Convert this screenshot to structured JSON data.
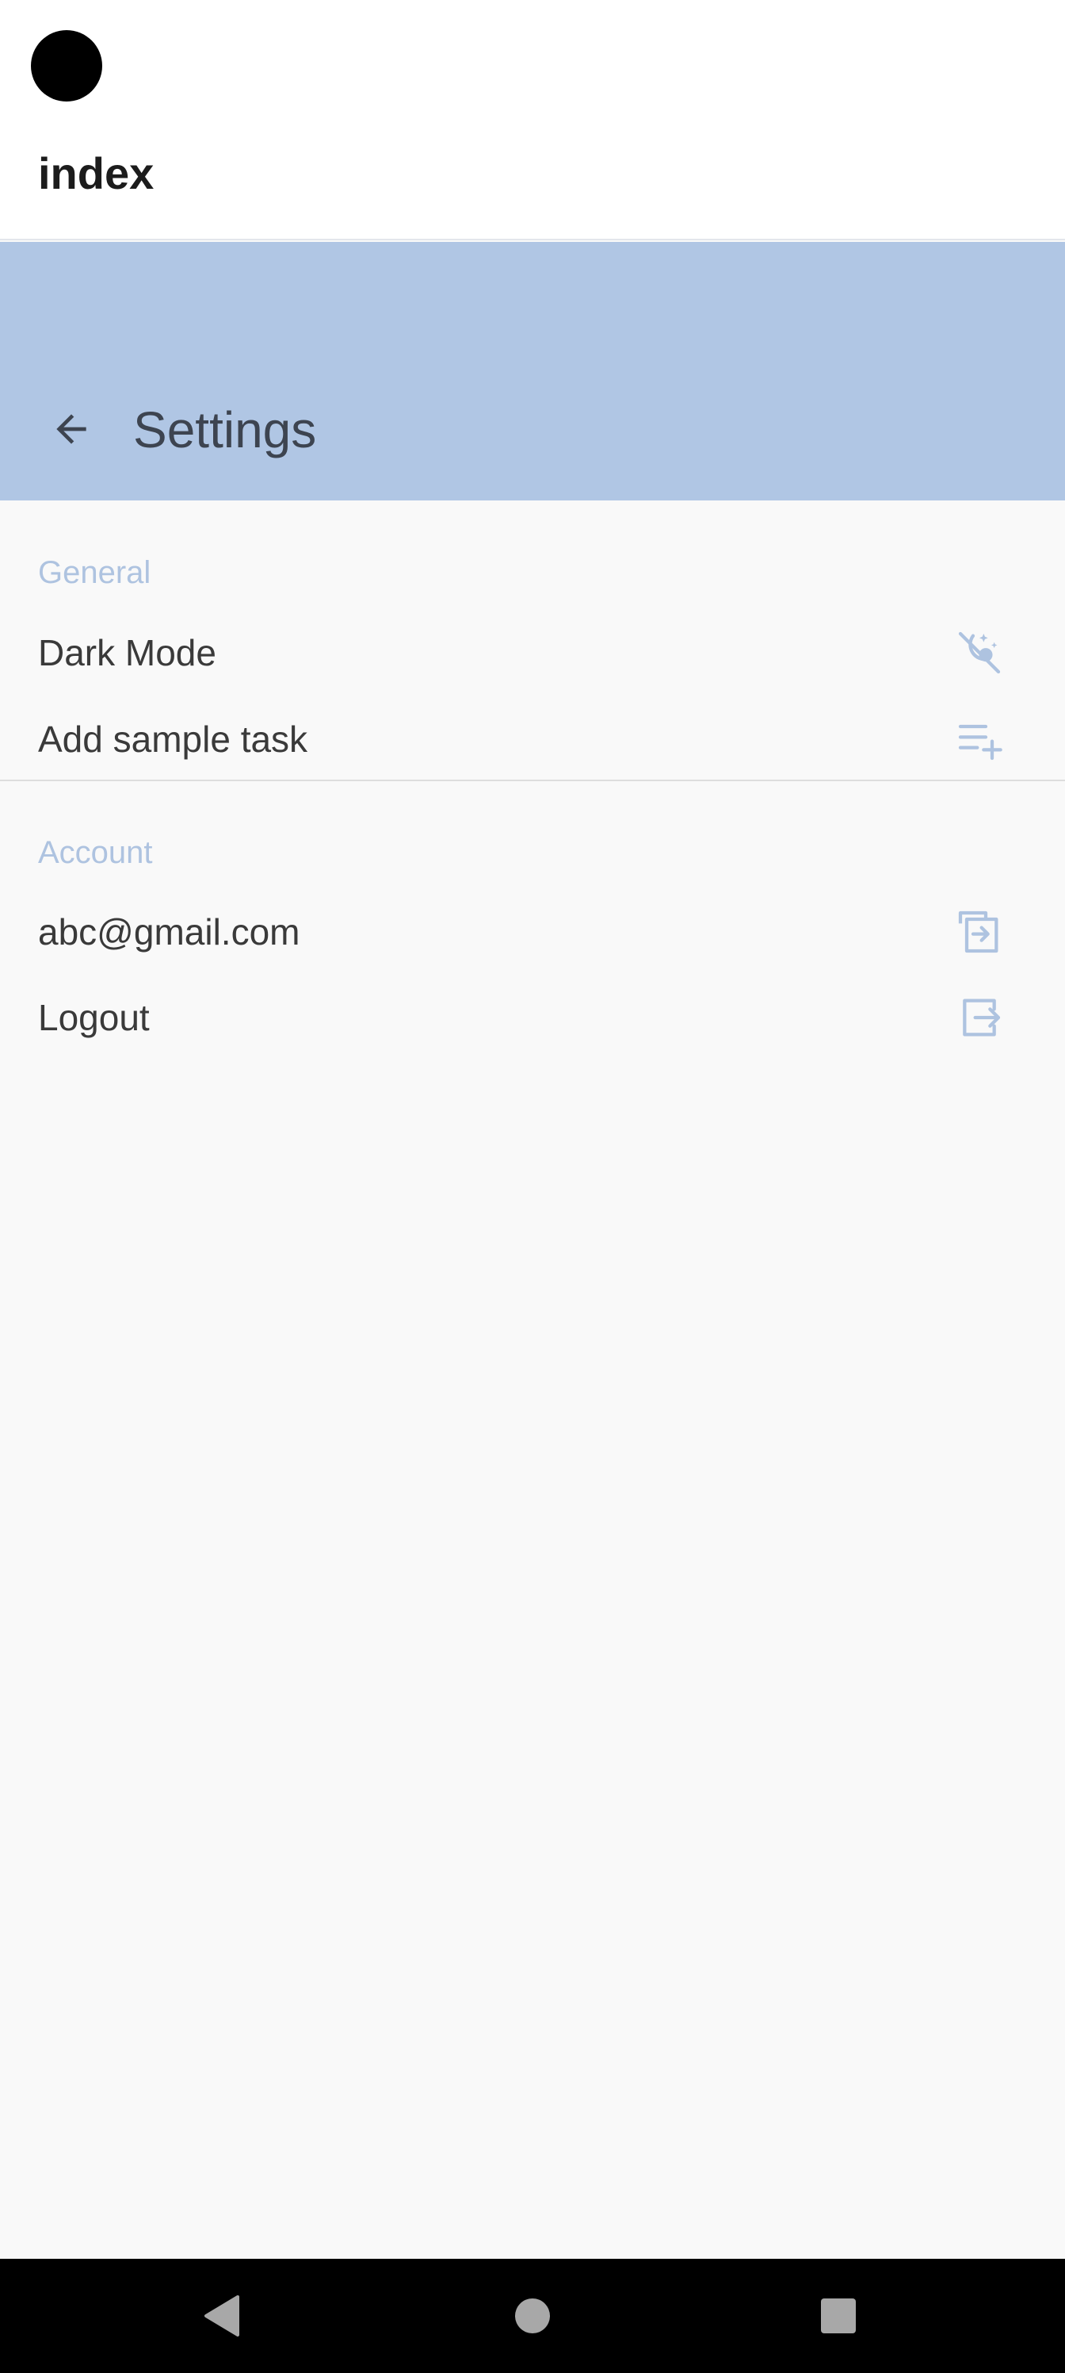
{
  "header": {
    "title": "index"
  },
  "app_bar": {
    "title": "Settings",
    "back_icon": "arrow-back-icon"
  },
  "sections": [
    {
      "header": "General",
      "items": [
        {
          "label": "Dark Mode",
          "icon": "dark-mode-icon"
        },
        {
          "label": "Add sample task",
          "icon": "playlist-add-icon"
        }
      ]
    },
    {
      "header": "Account",
      "items": [
        {
          "label": "abc@gmail.com",
          "icon": "switch-account-icon"
        },
        {
          "label": "Logout",
          "icon": "logout-icon"
        }
      ]
    }
  ],
  "colors": {
    "app_bar": "#b0c6e4",
    "accent": "#aec3e0",
    "background": "#f9f9f9"
  },
  "nav": {
    "back_icon": "nav-back-icon",
    "home_icon": "nav-home-icon",
    "recents_icon": "nav-recents-icon"
  }
}
